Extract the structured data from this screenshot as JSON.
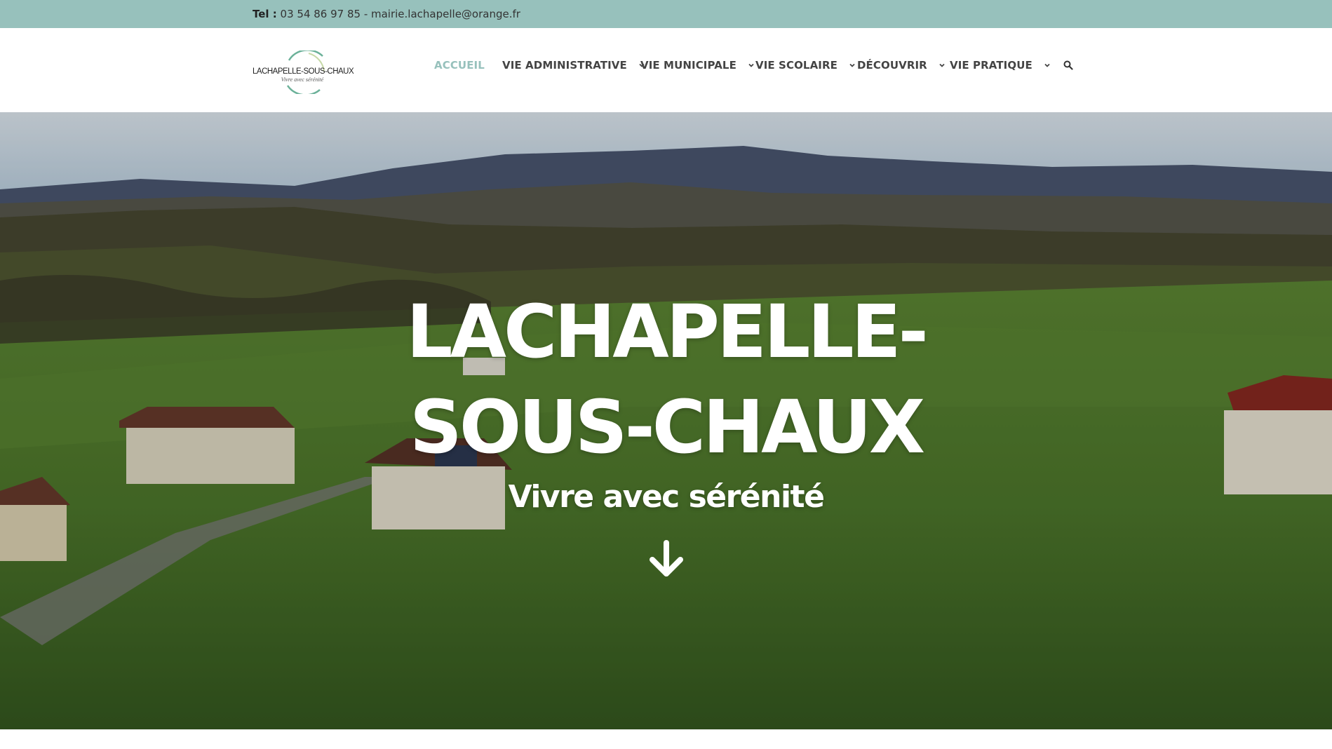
{
  "topbar": {
    "tel_label": "Tel :",
    "contact_text": " 03 54 86 97 85 - mairie.lachapelle@orange.fr"
  },
  "logo": {
    "title": "LACHAPELLE-SOUS-CHAUX",
    "tagline": "Vivre avec sérénité"
  },
  "nav": {
    "items": [
      {
        "label": "ACCUEIL",
        "active": true
      },
      {
        "label": "VIE ADMINISTRATIVE",
        "has_dropdown": true
      },
      {
        "label": "VIE MUNICIPALE",
        "has_dropdown": true
      },
      {
        "label": "VIE SCOLAIRE",
        "has_dropdown": true
      },
      {
        "label": "DÉCOUVRIR",
        "has_dropdown": true
      },
      {
        "label": "VIE PRATIQUE",
        "has_dropdown": true
      }
    ],
    "search_icon": "search-icon"
  },
  "hero": {
    "title_line1": "LACHAPELLE-",
    "title_line2": "SOUS-CHAUX",
    "subtitle": "Vivre avec sérénité",
    "arrow_icon": "arrow-down-icon"
  },
  "colors": {
    "accent": "#97c1bc",
    "nav_text": "#444444",
    "hero_text": "#ffffff"
  }
}
